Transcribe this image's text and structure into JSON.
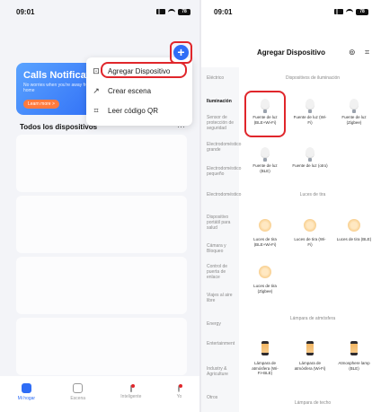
{
  "left": {
    "status_time": "09:01",
    "battery": "78",
    "banner": {
      "title": "Calls Notificat",
      "subtitle": "No worries when you're away from home",
      "button": "Learn more >"
    },
    "section_title": "Todos los dispositivos",
    "more_label": "···",
    "menu": [
      {
        "icon": "device-add-icon",
        "label": "Agregar Dispositivo"
      },
      {
        "icon": "scene-edit-icon",
        "label": "Crear escena"
      },
      {
        "icon": "qr-scan-icon",
        "label": "Leer código QR"
      }
    ],
    "tabs": [
      {
        "label": "Mi hogar",
        "active": true
      },
      {
        "label": "Escena",
        "active": false
      },
      {
        "label": "Inteligente",
        "active": false
      },
      {
        "label": "Yo",
        "active": false
      }
    ]
  },
  "right": {
    "status_time": "09:01",
    "battery": "78",
    "title": "Agregar Dispositivo",
    "categories": [
      {
        "label": "Eléctrico",
        "active": false
      },
      {
        "label": "Iluminación",
        "active": true
      },
      {
        "label": "Sensor de protección de seguridad",
        "active": false
      },
      {
        "label": "Electrodoméstico grande",
        "active": false
      },
      {
        "label": "Electrodoméstico pequeño",
        "active": false
      },
      {
        "label": "Electrodoméstico",
        "active": false
      },
      {
        "label": "Dispositivo portátil para salud",
        "active": false
      },
      {
        "label": "Cámara y Bloqueo",
        "active": false
      },
      {
        "label": "Control de puerta de enlace",
        "active": false
      },
      {
        "label": "Viajes al aire libre",
        "active": false
      },
      {
        "label": "Energy",
        "active": false
      },
      {
        "label": "Entertainment",
        "active": false
      },
      {
        "label": "Industry & Agriculture",
        "active": false
      },
      {
        "label": "Otros",
        "active": false
      }
    ],
    "sections": {
      "s1": "Dispositivos de iluminación",
      "s2": "Luces de tira",
      "s3": "Lámpara de atmósfera",
      "s4": "Lámpara de techo"
    },
    "items": {
      "b1": "Fuente de luz (BLE+Wi-Fi)",
      "b2": "Fuente de luz (Wi-Fi)",
      "b3": "Fuente de luz (Zigbee)",
      "b4": "Fuente de luz (BLE)",
      "b5": "Fuente de luz (otro)",
      "t1": "Luces de tira (BLE+Wi-Fi)",
      "t2": "Luces de tira (Wi-Fi)",
      "t3": "Luces de tira (BLE)",
      "t4": "Luces de tira (Zigbee)",
      "a1": "Lámpara de atmósfera (Wi-Fi+BLE)",
      "a2": "Lámpara de atmósfera (Wi-Fi)",
      "a3": "Atmosphere lamp (BLE)"
    }
  }
}
